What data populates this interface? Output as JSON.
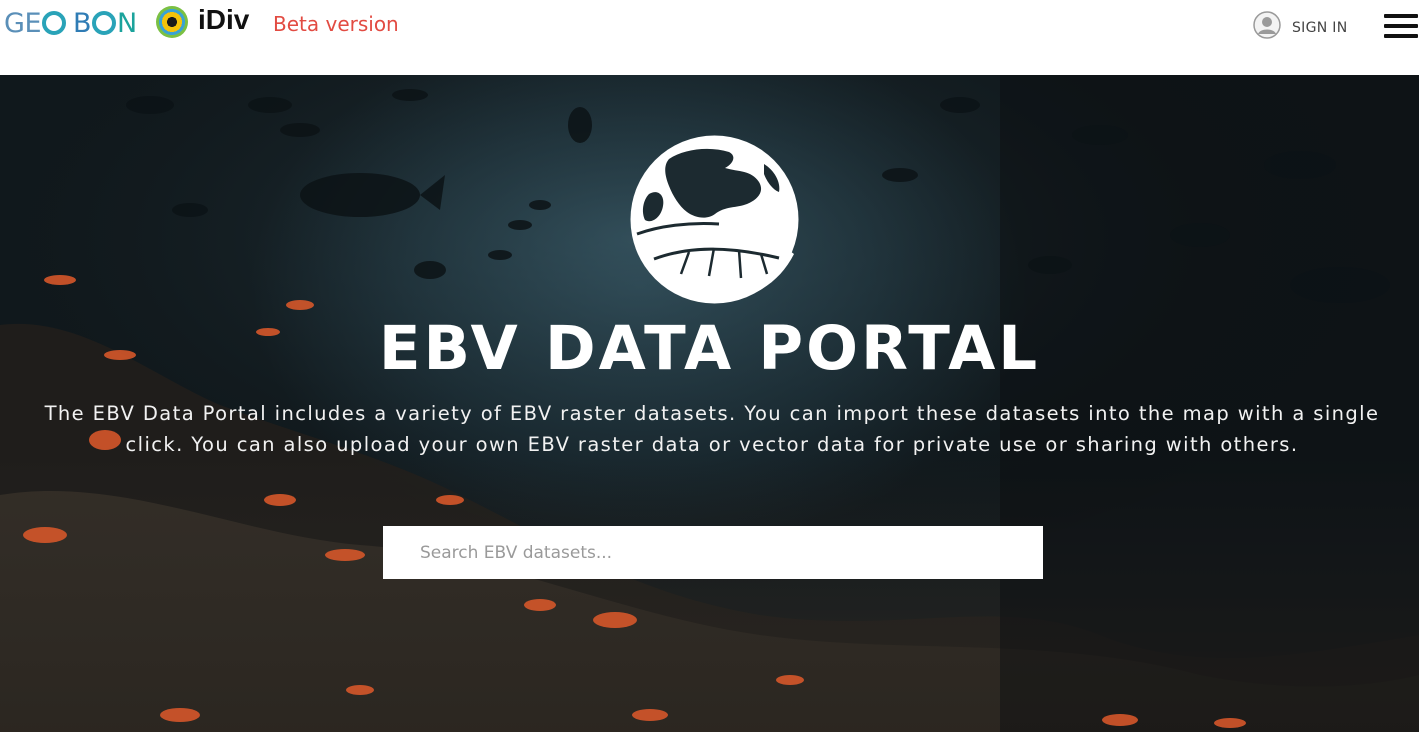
{
  "header": {
    "logo_geobon_parts": [
      "G",
      "E",
      "O",
      "B",
      "N"
    ],
    "logo_idiv_text": "iDiv",
    "beta_label": "Beta version",
    "signin_label": "SIGN IN",
    "icons": [
      "user-icon",
      "hamburger-menu-icon"
    ]
  },
  "hero": {
    "title": "EBV DATA PORTAL",
    "description": "The EBV Data Portal includes a variety of EBV raster datasets. You can import these datasets into the map with a single click. You can also upload your own EBV raster data or vector data for private use or sharing with others.",
    "search": {
      "placeholder": "Search EBV datasets...",
      "value": ""
    },
    "logo_icon": "globe-leaf-icon",
    "background": "underwater coral reef with fish"
  },
  "colors": {
    "beta": "#e24b42",
    "geobon_blue": "#2f7cb5",
    "geobon_teal": "#1ba39c",
    "hero_text": "#ffffff"
  }
}
